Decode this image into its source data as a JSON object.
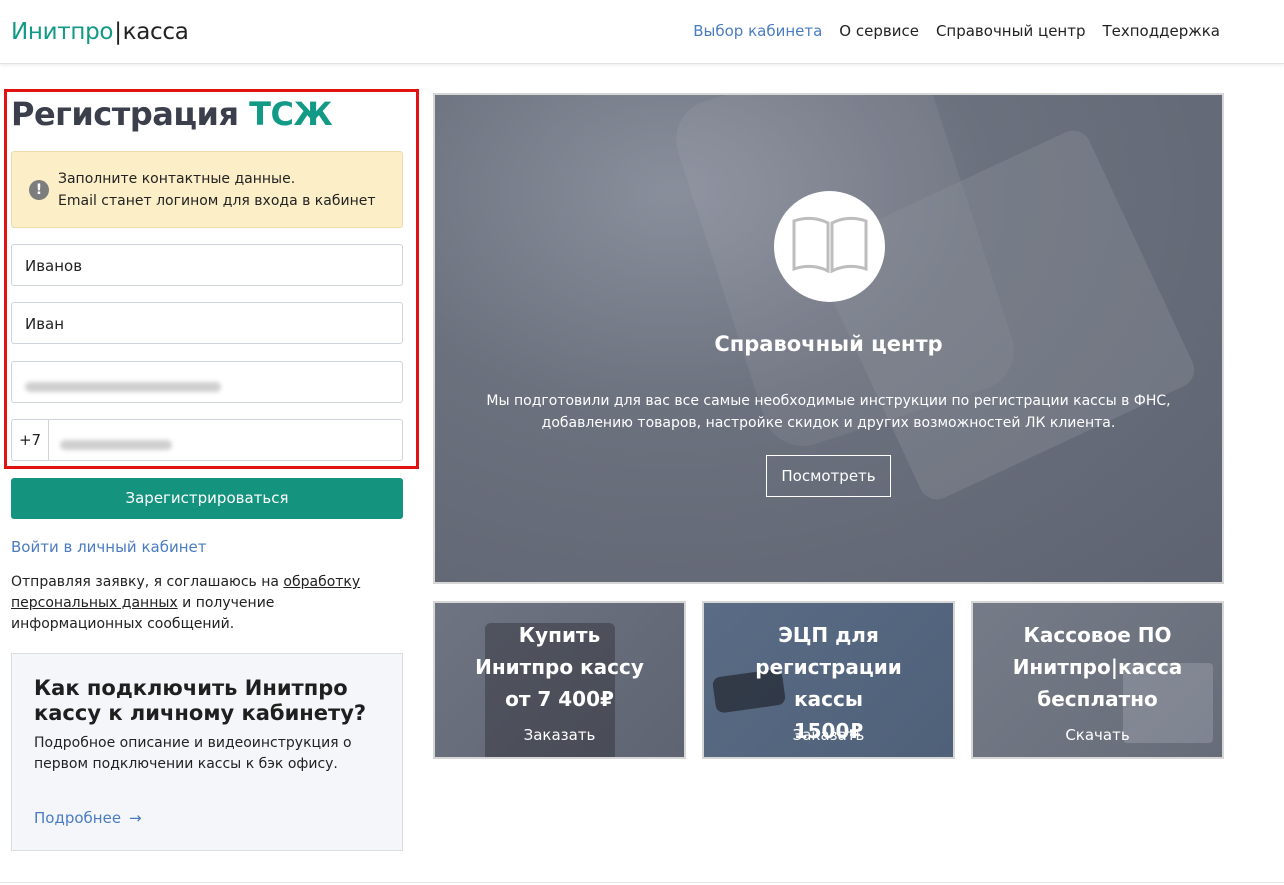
{
  "header": {
    "logo_brand": "Инитпро",
    "logo_separator": "|",
    "logo_product": "касса",
    "nav": [
      {
        "label": "Выбор кабинета"
      },
      {
        "label": "О сервисе"
      },
      {
        "label": "Справочный центр"
      },
      {
        "label": "Техподдержка"
      }
    ]
  },
  "registration": {
    "title_main": "Регистрация",
    "title_accent": "ТСЖ",
    "notice_line1": "Заполните контактные данные.",
    "notice_line2": "Email станет логином для входа в кабинет",
    "notice_icon": "!",
    "last_name_value": "Иванов",
    "first_name_value": "Иван",
    "phone_prefix": "+7",
    "submit_label": "Зарегистрироваться",
    "login_link": "Войти в личный кабинет",
    "consent_before": "Отправляя заявку, я соглашаюсь на ",
    "consent_link": "обработку персональных данных",
    "consent_after": " и получение информационных сообщений."
  },
  "howto": {
    "title": "Как подключить Инитпро кассу к личному кабинету?",
    "description": "Подробное описание и видеоинструкция о первом подключении кассы к бэк офису.",
    "more_label": "Подробнее",
    "arrow": "→"
  },
  "hero": {
    "title": "Справочный центр",
    "description_line1": "Мы подготовили для вас все самые необходимые инструкции по регистрации кассы в ФНС,",
    "description_line2": "добавлению товаров, настройке скидок и других возможностей ЛК клиента.",
    "button_label": "Посмотреть",
    "icon": "open-book-icon"
  },
  "tiles": [
    {
      "line1": "Купить",
      "line2": "Инитпро кассу",
      "line3": "от 7 400₽",
      "action": "Заказать"
    },
    {
      "line1": "ЭЦП для регистрации",
      "line2": "кассы",
      "line3": "1500₽",
      "action": "Заказать"
    },
    {
      "line1": "Кассовое ПО",
      "line2": "Инитпро|касса",
      "line3": "бесплатно",
      "action": "Скачать"
    }
  ],
  "colors": {
    "brand_green": "#139a86",
    "button_green": "#14937f",
    "link_blue": "#4a7cc2",
    "highlight_red": "#e01212",
    "notice_bg": "#fcefc7"
  }
}
